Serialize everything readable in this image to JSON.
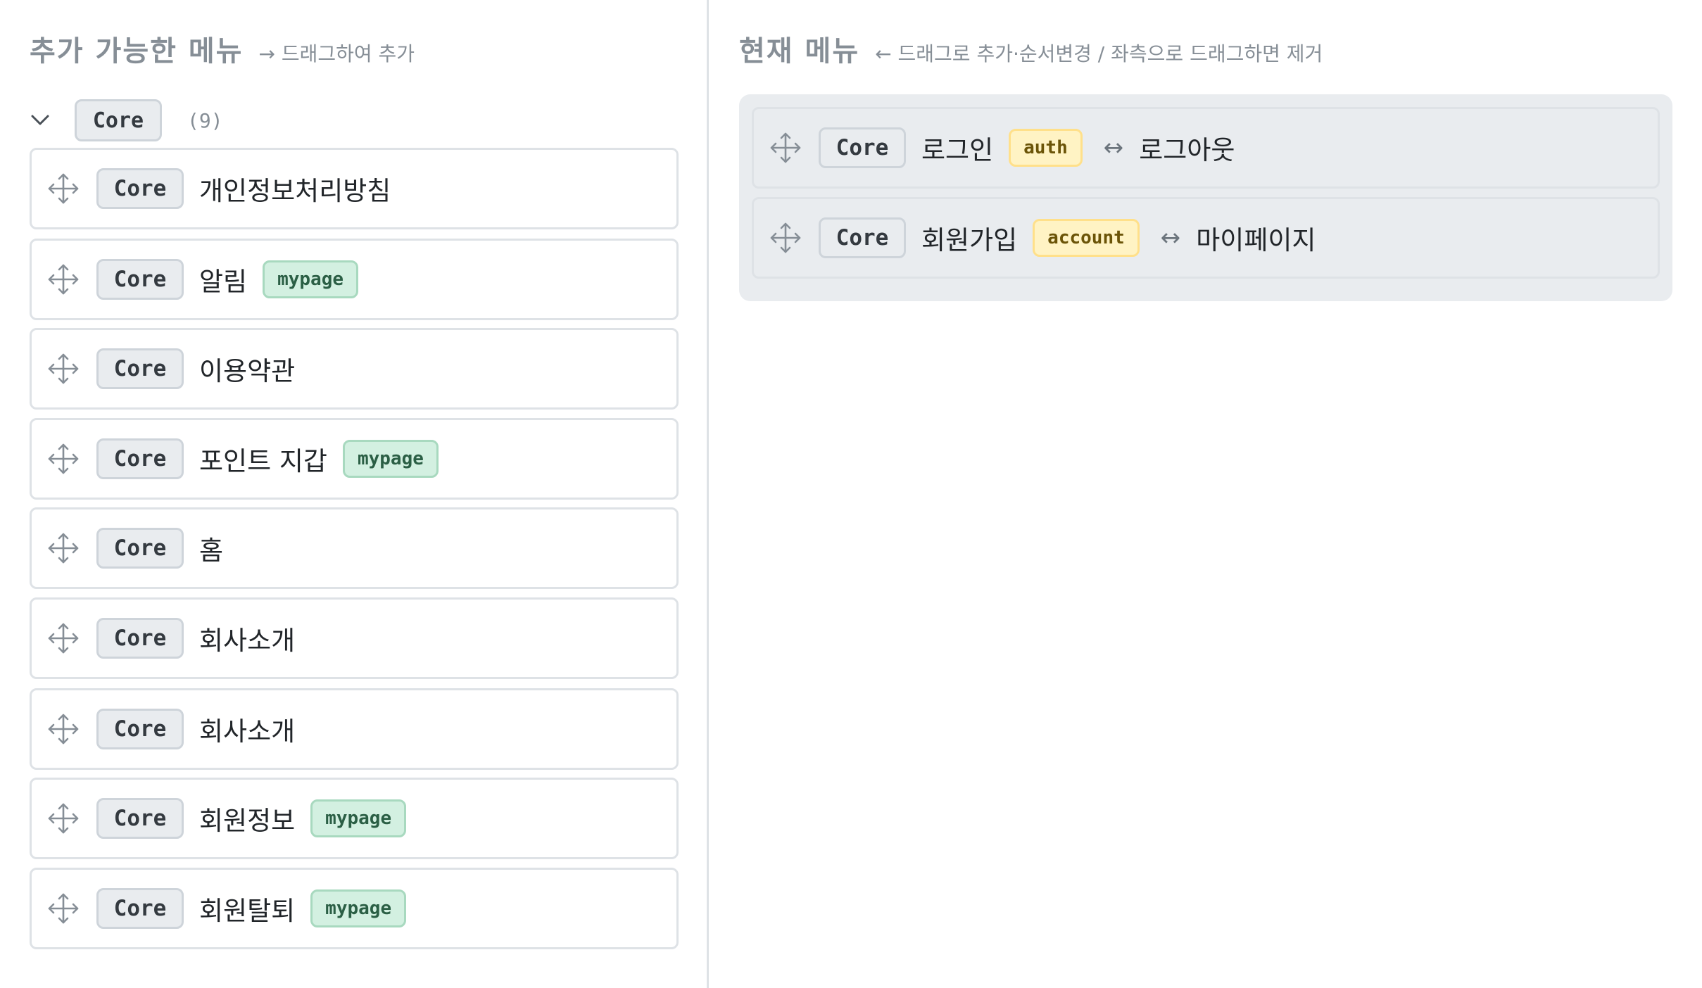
{
  "available": {
    "title": "추가 가능한 메뉴",
    "hint": "→ 드래그하여 추가",
    "group": {
      "badge": "Core",
      "count": "(9)"
    },
    "items": [
      {
        "badge": "Core",
        "label": "개인정보처리방침",
        "tag": ""
      },
      {
        "badge": "Core",
        "label": "알림",
        "tag": "mypage"
      },
      {
        "badge": "Core",
        "label": "이용약관",
        "tag": ""
      },
      {
        "badge": "Core",
        "label": "포인트 지갑",
        "tag": "mypage"
      },
      {
        "badge": "Core",
        "label": "홈",
        "tag": ""
      },
      {
        "badge": "Core",
        "label": "회사소개",
        "tag": ""
      },
      {
        "badge": "Core",
        "label": "회사소개",
        "tag": ""
      },
      {
        "badge": "Core",
        "label": "회원정보",
        "tag": "mypage"
      },
      {
        "badge": "Core",
        "label": "회원탈퇴",
        "tag": "mypage"
      }
    ]
  },
  "current": {
    "title": "현재 메뉴",
    "hint": "← 드래그로 추가·순서변경 / 좌측으로 드래그하면 제거",
    "items": [
      {
        "badge": "Core",
        "label": "로그인",
        "tag": "auth",
        "swap": "↔",
        "paired": "로그아웃"
      },
      {
        "badge": "Core",
        "label": "회원가입",
        "tag": "account",
        "swap": "↔",
        "paired": "마이페이지"
      }
    ]
  },
  "icons": {
    "move": "move-arrows-icon",
    "chevron": "chevron-down-icon"
  }
}
